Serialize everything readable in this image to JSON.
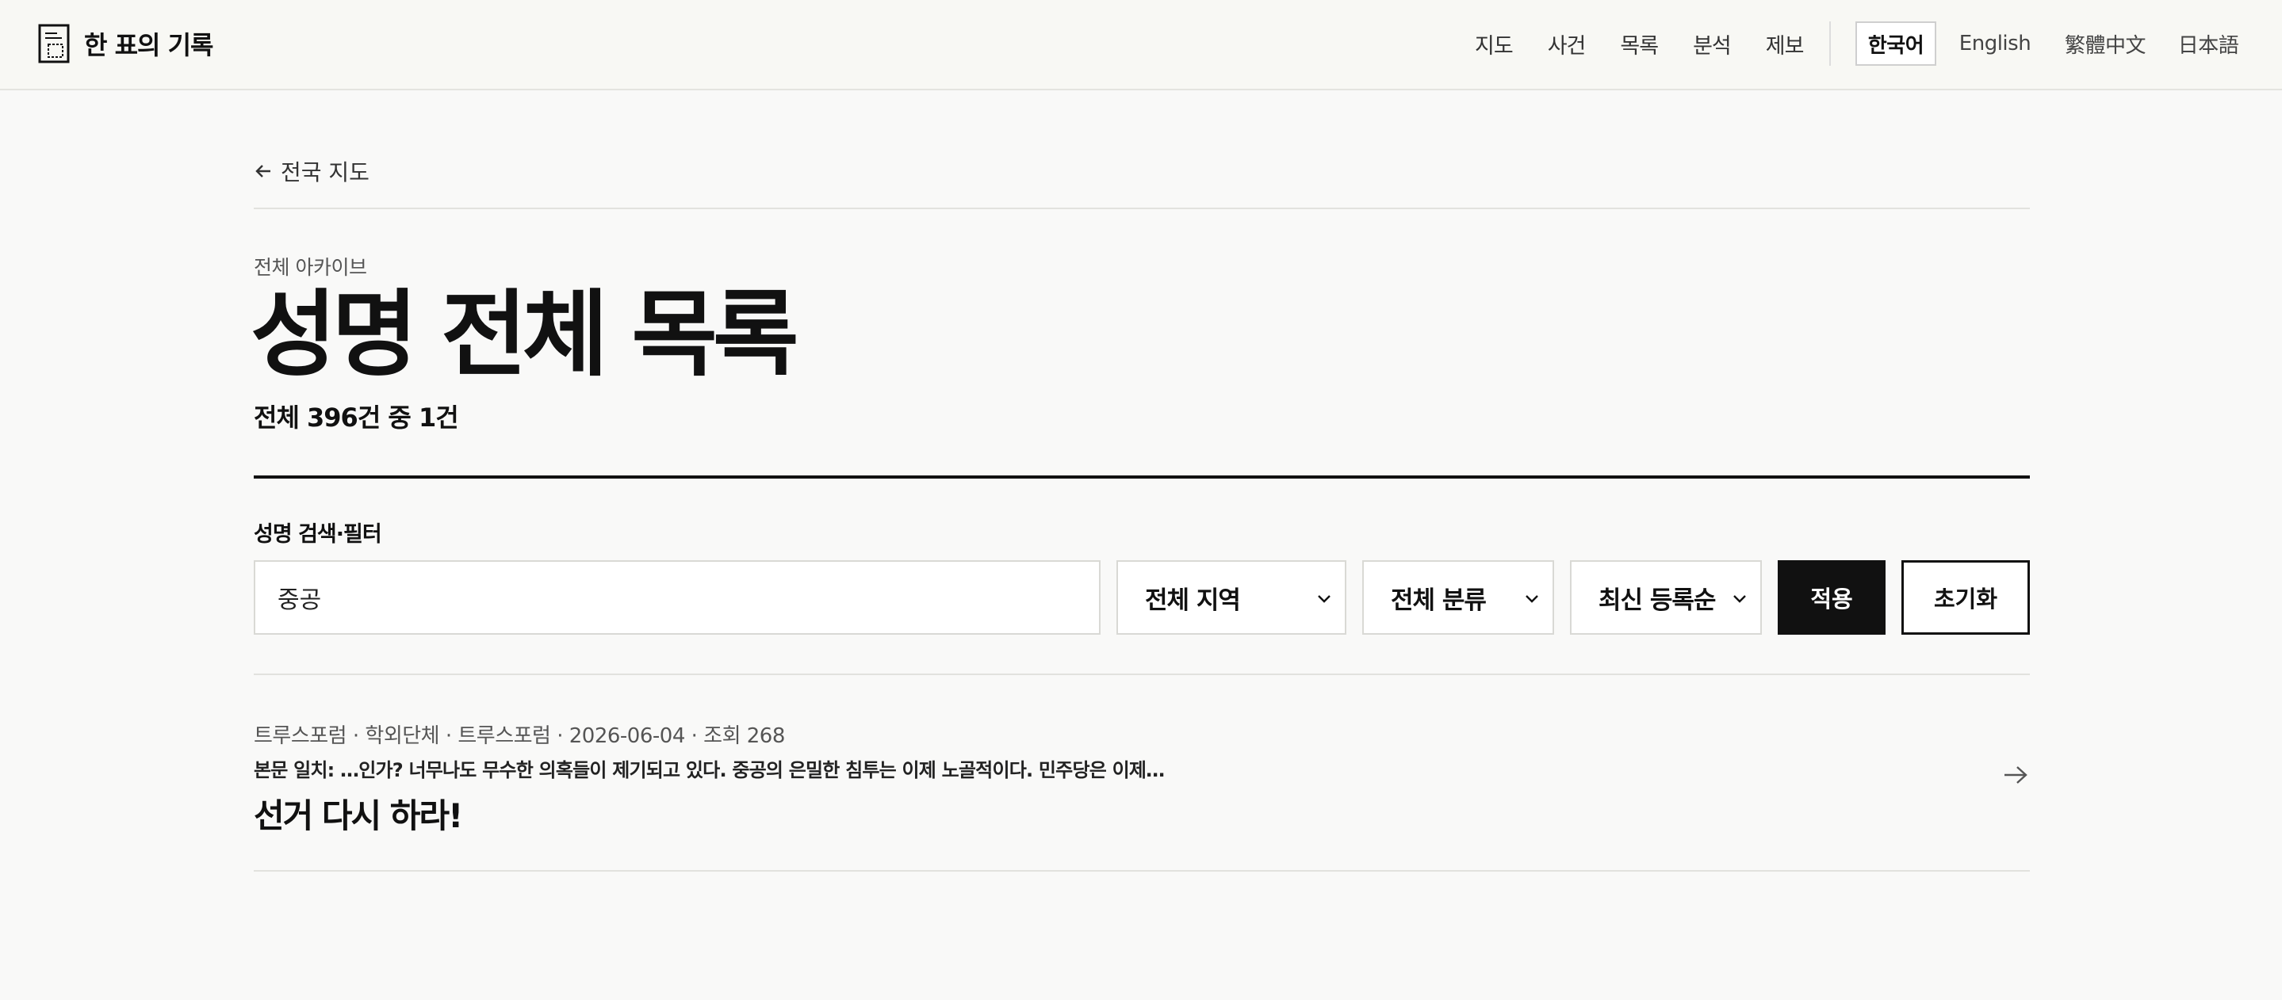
{
  "brand": {
    "name": "한 표의 기록",
    "icon": "document-icon"
  },
  "nav": {
    "items": [
      "지도",
      "사건",
      "목록",
      "분석",
      "제보"
    ]
  },
  "languages": {
    "items": [
      "한국어",
      "English",
      "繁體中文",
      "日本語"
    ],
    "active": "한국어"
  },
  "back_link": {
    "label": "전국 지도",
    "icon": "arrow-left-icon"
  },
  "page": {
    "eyebrow": "전체 아카이브",
    "title": "성명 전체 목록",
    "count": "전체 396건 중 1건"
  },
  "filter": {
    "section_label": "성명 검색·필터",
    "search_value": "중공",
    "region_select": "전체 지역",
    "category_select": "전체 분류",
    "sort_select": "최신 등록순",
    "apply_label": "적용",
    "reset_label": "초기화"
  },
  "results": [
    {
      "meta": "트루스포럼 · 학외단체 · 트루스포럼 · 2026-06-04 · 조회 268",
      "snippet": "본문 일치: …인가? 너무나도 무수한 의혹들이 제기되고 있다. 중공의 은밀한 침투는 이제 노골적이다. 민주당은 이제…",
      "title": "선거 다시 하라!",
      "icon": "arrow-right-icon"
    }
  ]
}
